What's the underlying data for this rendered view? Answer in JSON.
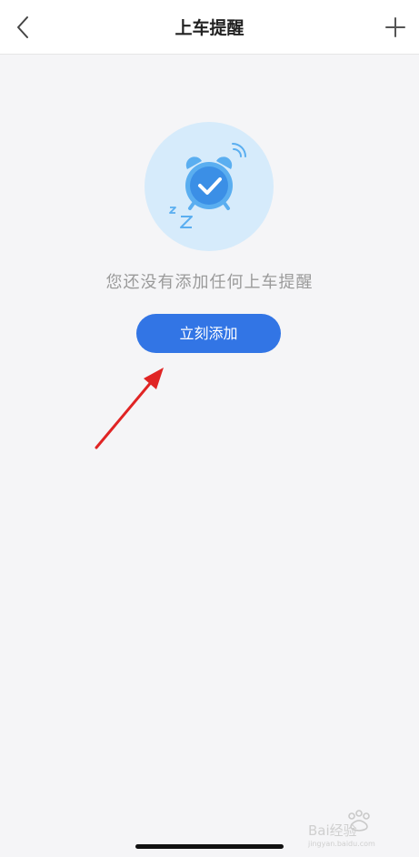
{
  "header": {
    "title": "上车提醒",
    "back_icon": "chevron-left-icon",
    "add_icon": "plus-icon"
  },
  "empty_state": {
    "illustration_icon": "alarm-clock-check-icon",
    "message": "您还没有添加任何上车提醒",
    "button_label": "立刻添加"
  },
  "colors": {
    "accent": "#3275e5",
    "background": "#f5f5f7",
    "empty_text": "#9a9a9a",
    "annotation": "#e02424"
  },
  "watermark": {
    "text": "Bai经验",
    "sub": "jingyan.baidu.com"
  }
}
